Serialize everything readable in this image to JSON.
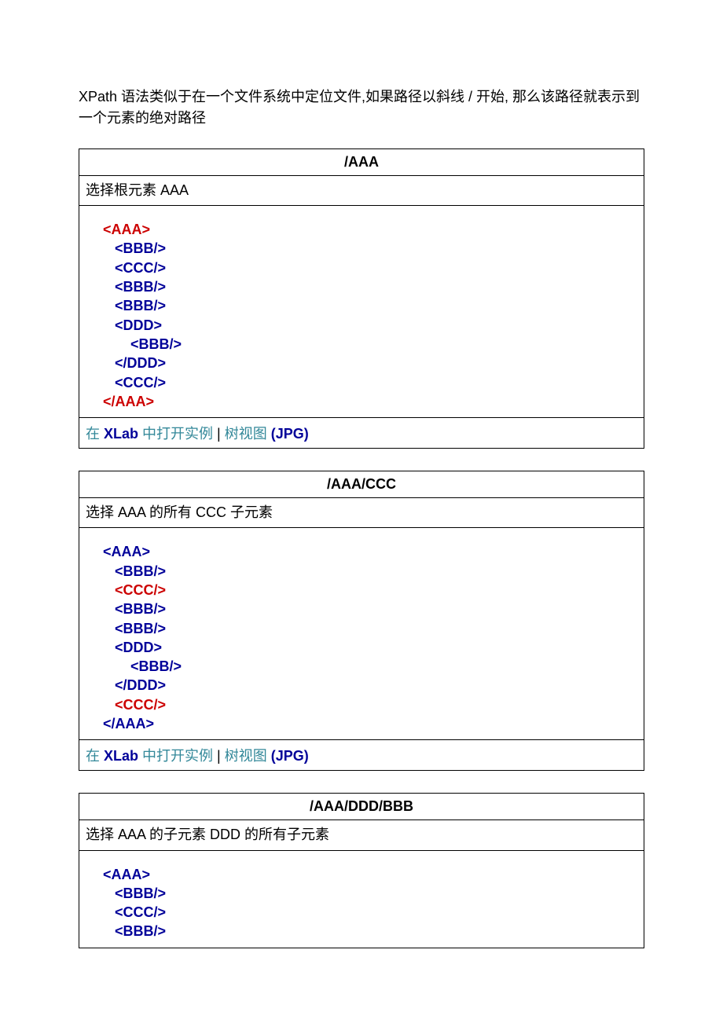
{
  "intro": "XPath 语法类似于在一个文件系统中定位文件,如果路径以斜线 / 开始, 那么该路径就表示到一个元素的绝对路径",
  "examples": [
    {
      "title": "/AAA",
      "desc": "选择根元素 AAA",
      "code_html": "<span class=\"hl\">&lt;AAA&gt;</span>\n   &lt;BBB/&gt;\n   &lt;CCC/&gt;\n   &lt;BBB/&gt;\n   &lt;BBB/&gt;\n   &lt;DDD&gt;\n       &lt;BBB/&gt;\n   &lt;/DDD&gt;\n   &lt;CCC/&gt;\n<span class=\"hl\">&lt;/AAA&gt;</span>",
      "footer": {
        "pre": "在 ",
        "xlab": "XLab",
        "post": " 中打开实例",
        "sep": " | ",
        "link2": "树视图 ",
        "jpg": "(JPG)"
      }
    },
    {
      "title": "/AAA/CCC",
      "desc": "选择 AAA 的所有 CCC 子元素",
      "code_html": "&lt;AAA&gt;\n   &lt;BBB/&gt;\n   <span class=\"hl\">&lt;CCC/&gt;</span>\n   &lt;BBB/&gt;\n   &lt;BBB/&gt;\n   &lt;DDD&gt;\n       &lt;BBB/&gt;\n   &lt;/DDD&gt;\n   <span class=\"hl\">&lt;CCC/&gt;</span>\n&lt;/AAA&gt;",
      "footer": {
        "pre": "在 ",
        "xlab": "XLab",
        "post": " 中打开实例",
        "sep": " | ",
        "link2": "树视图 ",
        "jpg": "(JPG)"
      }
    },
    {
      "title": "/AAA/DDD/BBB",
      "desc": "选择 AAA 的子元素 DDD 的所有子元素",
      "code_html": "&lt;AAA&gt;\n   &lt;BBB/&gt;\n   &lt;CCC/&gt;\n   &lt;BBB/&gt;",
      "footer": null
    }
  ]
}
